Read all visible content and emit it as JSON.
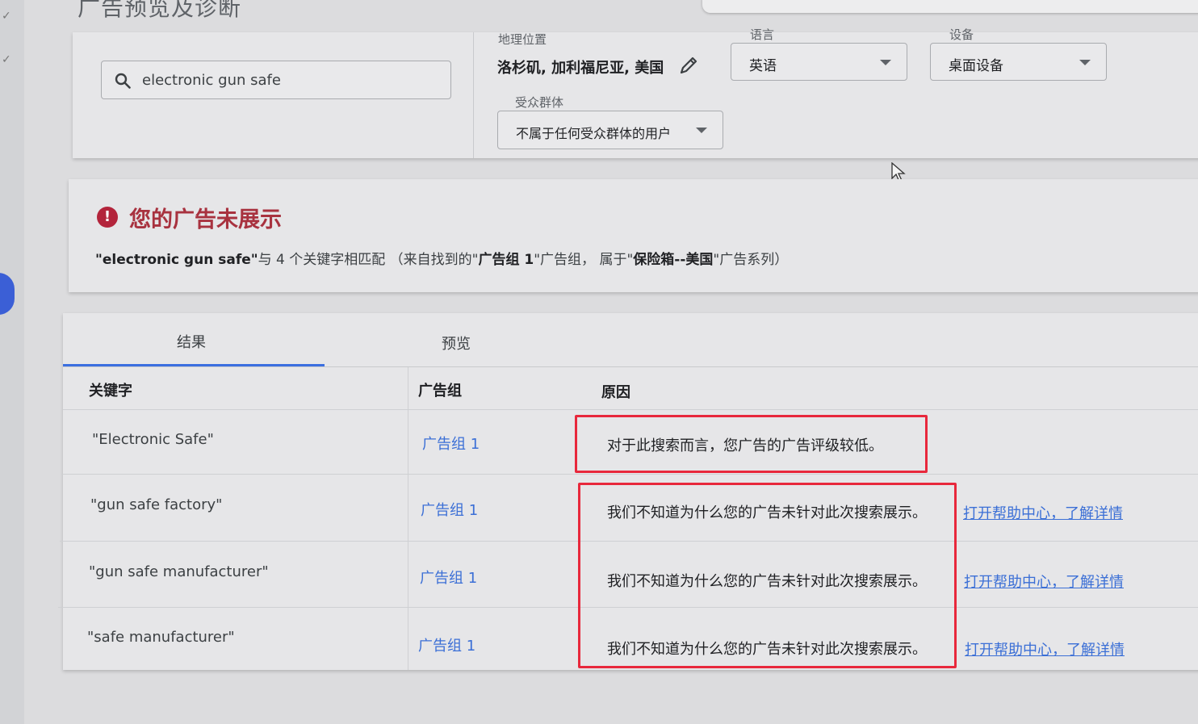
{
  "page_title": "广告预览及诊断",
  "search": {
    "value": "electronic gun safe"
  },
  "location": {
    "label": "地理位置",
    "value": "洛杉矶, 加利福尼亚, 美国"
  },
  "language": {
    "label": "语言",
    "value": "英语"
  },
  "device": {
    "label": "设备",
    "value": "桌面设备"
  },
  "audience": {
    "label": "受众群体",
    "value": "不属于任何受众群体的用户"
  },
  "status": {
    "title": "您的广告未展示",
    "match": {
      "part1": "\"electronic gun safe\"",
      "part2": "与 4 个关键字相匹配 （来自找到的\"",
      "part3": "广告组 1",
      "part4": "\"广告组， 属于\"",
      "part5": "保险箱--美国",
      "part6": "\"广告系列）"
    }
  },
  "tabs": [
    {
      "label": "结果"
    },
    {
      "label": "预览"
    }
  ],
  "table": {
    "headers": {
      "keyword": "关键字",
      "adgroup": "广告组",
      "reason": "原因"
    },
    "rows": [
      {
        "keyword": "\"Electronic Safe\"",
        "adgroup": "广告组 1",
        "reason": "对于此搜索而言，您广告的广告评级较低。",
        "help": ""
      },
      {
        "keyword": "\"gun safe factory\"",
        "adgroup": "广告组 1",
        "reason": "我们不知道为什么您的广告未针对此次搜索展示。",
        "help": "打开帮助中心，了解详情"
      },
      {
        "keyword": "\"gun safe manufacturer\"",
        "adgroup": "广告组 1",
        "reason": "我们不知道为什么您的广告未针对此次搜索展示。",
        "help": "打开帮助中心，了解详情"
      },
      {
        "keyword": "\"safe manufacturer\"",
        "adgroup": "广告组 1",
        "reason": "我们不知道为什么您的广告未针对此次搜索展示。",
        "help": "打开帮助中心，了解详情"
      }
    ]
  },
  "colors": {
    "error": "#a8323f",
    "link": "#3b6fd6",
    "highlight": "#e8283c",
    "tab_active": "#3b6fe0"
  }
}
